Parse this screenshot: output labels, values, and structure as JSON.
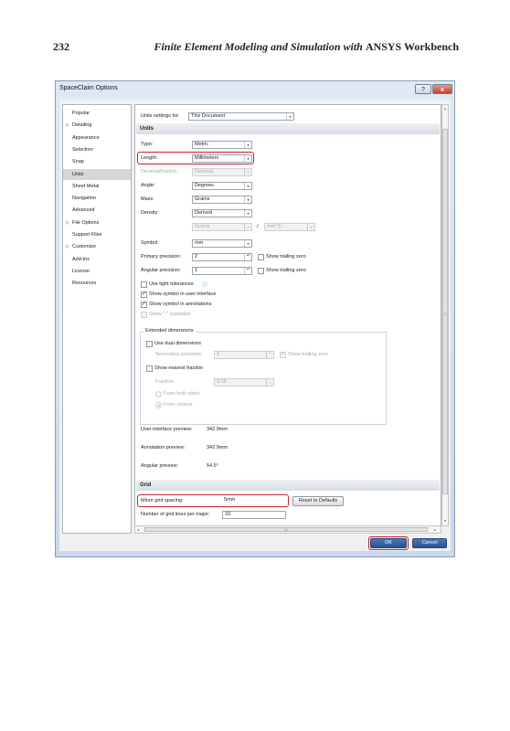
{
  "book": {
    "page_number": "232",
    "title_italic": "Finite Element Modeling and Simulation with",
    "title_upright": "ANSYS Workbench"
  },
  "window": {
    "title": "SpaceClaim Options",
    "help_glyph": "?",
    "close_glyph": "x"
  },
  "nav": {
    "items": [
      {
        "label": "Popular",
        "expandable": false,
        "selected": false
      },
      {
        "label": "Detailing",
        "expandable": true,
        "selected": false
      },
      {
        "label": "Appearance",
        "expandable": false,
        "selected": false
      },
      {
        "label": "Selection",
        "expandable": false,
        "selected": false
      },
      {
        "label": "Snap",
        "expandable": false,
        "selected": false
      },
      {
        "label": "Units",
        "expandable": false,
        "selected": true
      },
      {
        "label": "Sheet Metal",
        "expandable": false,
        "selected": false
      },
      {
        "label": "Navigation",
        "expandable": false,
        "selected": false
      },
      {
        "label": "Advanced",
        "expandable": false,
        "selected": false
      },
      {
        "label": "File Options",
        "expandable": true,
        "selected": false
      },
      {
        "label": "Support Files",
        "expandable": false,
        "selected": false
      },
      {
        "label": "Customize",
        "expandable": true,
        "selected": false
      },
      {
        "label": "Add-Ins",
        "expandable": false,
        "selected": false
      },
      {
        "label": "License",
        "expandable": false,
        "selected": false
      },
      {
        "label": "Resources",
        "expandable": false,
        "selected": false
      }
    ],
    "expand_glyph": "▷"
  },
  "units_for": {
    "label": "Units settings for:",
    "value": "This Document"
  },
  "units_section": {
    "header": "Units",
    "type": {
      "label": "Type:",
      "value": "Metric"
    },
    "length": {
      "label": "Length:",
      "value": "Millimeters"
    },
    "decimal_fraction": {
      "label": "Decimal/fraction:",
      "value": "Decimal"
    },
    "angle": {
      "label": "Angle:",
      "value": "Degrees"
    },
    "mass": {
      "label": "Mass:",
      "value": "Grams"
    },
    "density": {
      "label": "Density:",
      "value": "Derived"
    },
    "density_mass": "Grams",
    "density_slash": "/",
    "density_volume": "mm^3",
    "symbol": {
      "label": "Symbol:",
      "value": "mm"
    },
    "primary_precision": {
      "label": "Primary precision:",
      "value": "2",
      "trailing_zero": "Show trailing zero"
    },
    "angular_precision": {
      "label": "Angular precision:",
      "value": "1",
      "trailing_zero": "Show trailing zero"
    },
    "tight_tolerances": {
      "label": "Use tight tolerances",
      "checked": false
    },
    "symbol_ui": {
      "label": "Show symbol in user interface",
      "checked": true
    },
    "symbol_annotations": {
      "label": "Show symbol in annotations",
      "checked": true
    },
    "separator": {
      "label": "Show \"-\" separator",
      "checked": false
    }
  },
  "extended": {
    "title": "Extended dimensions",
    "dual": {
      "label": "Use dual dimensions",
      "checked": false
    },
    "secondary_precision": {
      "label": "Secondary precision:",
      "value": "3",
      "trailing_zero": "Show trailing zero"
    },
    "nearest_fraction": {
      "label": "Show nearest fraction",
      "checked": false
    },
    "fraction": {
      "label": "Fraction:",
      "value": "1/16"
    },
    "from_both": {
      "label": "From both sides"
    },
    "from_closest": {
      "label": "From closest"
    }
  },
  "previews": {
    "ui": {
      "label": "User interface preview:",
      "value": "342.9mm"
    },
    "annotation": {
      "label": "Annotation preview:",
      "value": "342.9mm"
    },
    "angular": {
      "label": "Angular preview:",
      "value": "54.5°"
    }
  },
  "grid": {
    "header": "Grid",
    "minor": {
      "label": "Minor grid spacing:",
      "value": "5mm"
    },
    "reset_label": "Reset to Defaults",
    "major": {
      "label": "Number of grid lines per major:",
      "value": "10"
    }
  },
  "footer": {
    "ok": "OK",
    "cancel": "Cancel"
  },
  "glyphs": {
    "dropdown": "▾",
    "spin": "▴▾",
    "check": "✓",
    "info": "ⓘ",
    "up": "▴",
    "down": "▾",
    "left": "◂",
    "right": "▸",
    "grip": "III",
    "vgrip": "≡"
  },
  "colors": {
    "highlight": "#c8242b",
    "ok_button": "#2a528e",
    "selected_nav": "#d6d6d6"
  }
}
